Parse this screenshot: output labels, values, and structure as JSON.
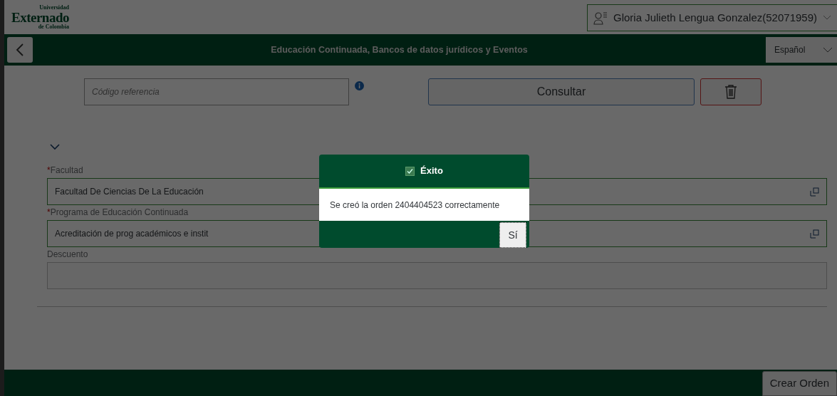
{
  "header": {
    "logo": {
      "top": "Universidad",
      "main": "Externado",
      "bottom": "de Colombia"
    },
    "user": "Gloria Julieth Lengua Gonzalez(52071959)"
  },
  "navbar": {
    "title": "Educación Continuada, Bancos de datos jurídicos y Eventos",
    "language": "Español"
  },
  "search": {
    "placeholder": "Código referencia",
    "button": "Consultar"
  },
  "form": {
    "fields": [
      {
        "label": "Facultad",
        "required_marker": "*",
        "value": "Facultad De Ciencias De La Educación",
        "kind": "lookup"
      },
      {
        "label": "Programa de Educación Continuada",
        "required_marker": "*",
        "value": "Acreditación de prog académicos e instit",
        "kind": "lookup"
      },
      {
        "label": "Descuento",
        "kind": "plain"
      }
    ]
  },
  "footer": {
    "button": "Crear Orden"
  },
  "dialog": {
    "title": "Éxito",
    "message": "Se creó la orden 2404404523 correctamente",
    "button": "Sí"
  }
}
